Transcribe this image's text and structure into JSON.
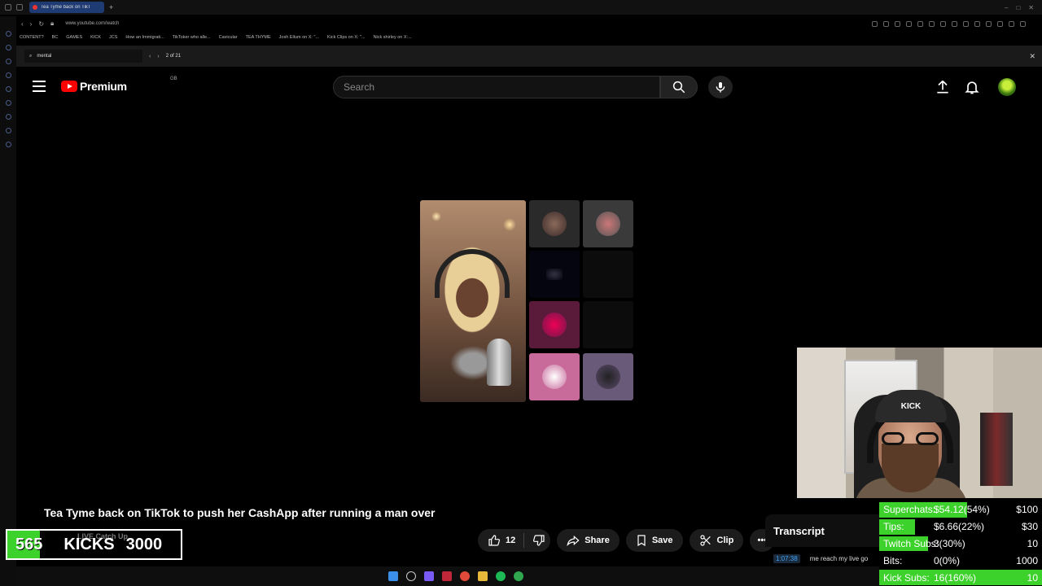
{
  "browser": {
    "tab_title": "Tea Tyme back on TikT",
    "url": "www.youtube.com/watch",
    "bookmarks": [
      "CONTENT?",
      "BC",
      "GAMES",
      "KICK",
      "JCS",
      "How an Immigrati...",
      "TikToker who alle...",
      "Cavicular",
      "TEA THYME",
      "Josh Ellum on X: \"...",
      "Kick Clips on X: \"...",
      "Nick shirley on X:..."
    ]
  },
  "find_bar": {
    "query": "mental",
    "match_count": "2 of 21"
  },
  "youtube": {
    "brand": "Premium",
    "country_code": "GB",
    "search_placeholder": "Search"
  },
  "video": {
    "title": "Tea Tyme back on TikTok to push her CashApp after running a man over",
    "likes": "12",
    "share_label": "Share",
    "save_label": "Save",
    "clip_label": "Clip"
  },
  "transcript": {
    "header": "Transcript",
    "timestamp": "1:07:38",
    "text": "me reach my live go"
  },
  "webcam": {
    "cap_text": "KICK"
  },
  "kicks_goal": {
    "current": "565",
    "label": "KICKS",
    "goal": "3000",
    "ghost_text": "LIVE Catch Up",
    "progress": 0.19
  },
  "goals": [
    {
      "label": "Superchats:",
      "value": "$54.12(54%)",
      "target": "$100",
      "progress": 0.54
    },
    {
      "label": "Tips:",
      "value": "$6.66(22%)",
      "target": "$30",
      "progress": 0.22
    },
    {
      "label": "Twitch Subs:",
      "value": "3(30%)",
      "target": "10",
      "progress": 0.3
    },
    {
      "label": "Bits:",
      "value": "0(0%)",
      "target": "1000",
      "progress": 0.0
    },
    {
      "label": "Kick Subs:",
      "value": "16(160%)",
      "target": "10",
      "progress": 1.0
    }
  ],
  "colors": {
    "accent_green": "#3dd12b",
    "youtube_red": "#ff0000"
  }
}
